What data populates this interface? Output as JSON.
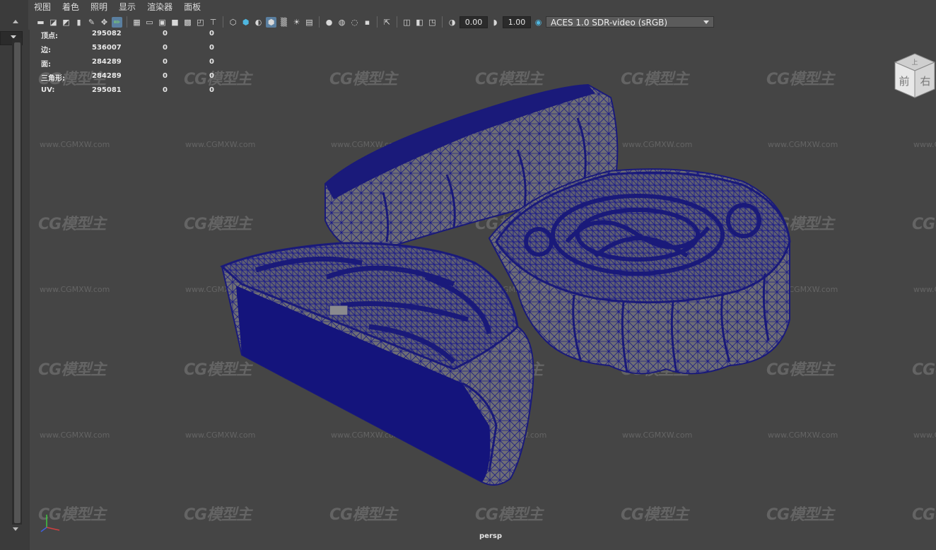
{
  "menu": [
    "视图",
    "着色",
    "照明",
    "显示",
    "渲染器",
    "面板"
  ],
  "toolbar": {
    "exposure": "0.00",
    "gamma": "1.00",
    "colorspace": "ACES 1.0 SDR-video (sRGB)",
    "icons": [
      "camera-icon",
      "camera-attr-icon",
      "bookmark-icon",
      "image-plane-icon",
      "2d-pan-icon",
      "grease-pencil-icon",
      "grid-icon",
      "film-gate-icon",
      "resolution-gate-icon",
      "gate-mask-icon",
      "field-chart-icon",
      "safe-action-icon",
      "safe-title-icon",
      "wireframe-icon",
      "smooth-shade-icon",
      "default-material-icon",
      "wireframe-on-shaded-icon",
      "xray-icon",
      "textured-icon",
      "use-all-lights-icon",
      "shadows-icon",
      "screen-ambient-occlusion-icon",
      "motion-blur-icon",
      "anti-alias-icon",
      "depth-of-field-icon",
      "isolate-select-icon",
      "xray-active-icon",
      "xray-joints-icon",
      "backface-culling-icon",
      "exposure-icon",
      "gamma-icon",
      "color-management-icon"
    ]
  },
  "hud": {
    "rows": [
      {
        "label": "顶点:",
        "v1": "295082",
        "v2": "0",
        "v3": "0"
      },
      {
        "label": "边:",
        "v1": "536007",
        "v2": "0",
        "v3": "0"
      },
      {
        "label": "面:",
        "v1": "284289",
        "v2": "0",
        "v3": "0"
      },
      {
        "label": "三角形:",
        "v1": "284289",
        "v2": "0",
        "v3": "0"
      },
      {
        "label": "UV:",
        "v1": "295081",
        "v2": "0",
        "v3": "0"
      }
    ]
  },
  "viewcube": {
    "front": "前",
    "right": "右",
    "top": "上"
  },
  "camera_label": "persp",
  "watermark": {
    "logo": "CG模型主",
    "url": "www.CGMXW.com"
  },
  "colors": {
    "wire": "#1a1a7a",
    "viewport_bg": "#454545",
    "mesh_fill": "#6e6e73"
  }
}
